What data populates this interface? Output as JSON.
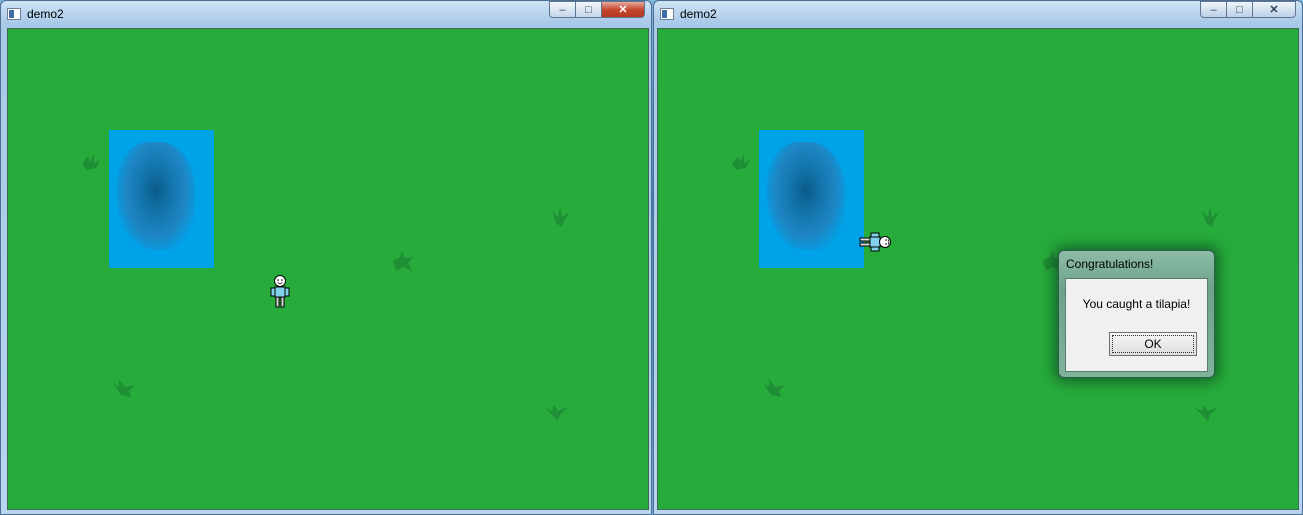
{
  "windows": [
    {
      "title": "demo2",
      "buttons": {
        "minimize": "–",
        "maximize": "□",
        "close": "✕"
      }
    },
    {
      "title": "demo2",
      "buttons": {
        "minimize": "–",
        "maximize": "□",
        "close": "✕"
      }
    }
  ],
  "scene": {
    "grass_color": "#27ac3c",
    "water_color": "#00a2e8",
    "tuft_color": "#1f8f35"
  },
  "dialog": {
    "title": "Congratulations!",
    "message": "You caught a tilapia!",
    "ok_label": "OK"
  }
}
